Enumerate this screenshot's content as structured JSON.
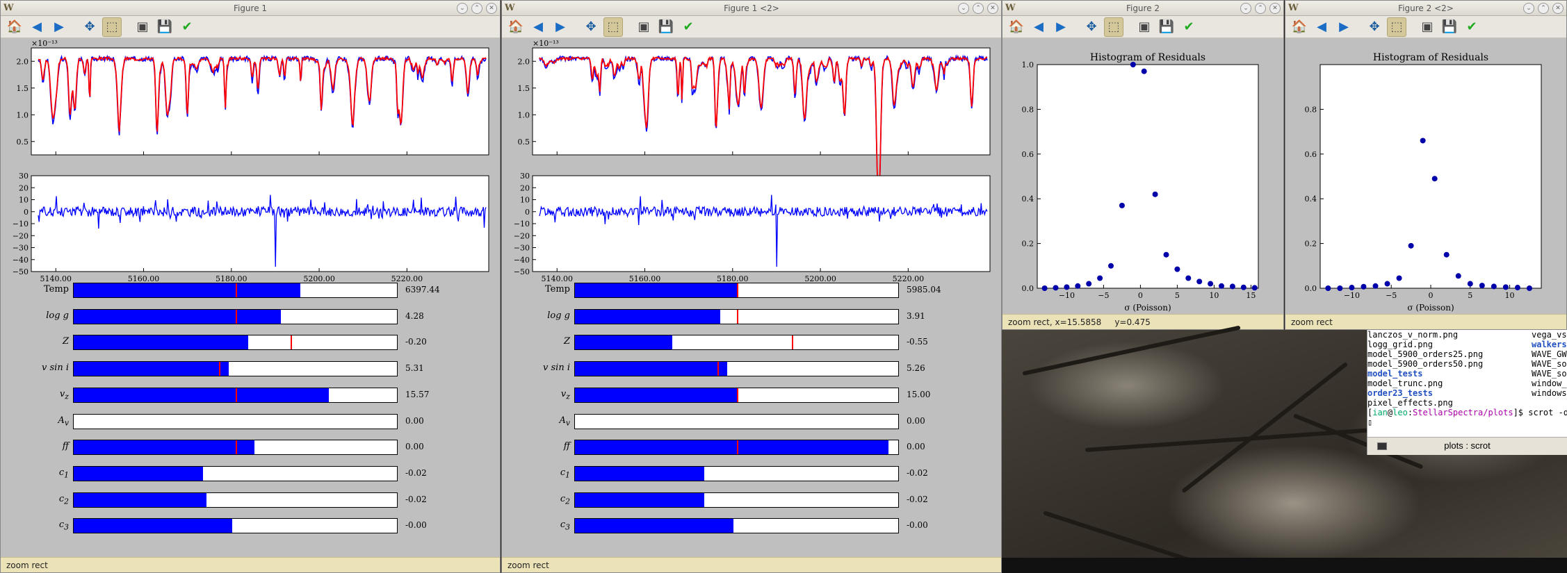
{
  "windows": [
    {
      "title": "Figure 1",
      "status": "zoom rect",
      "top_offset_exponent": "×10⁻¹³",
      "spectrum_yticks": [
        "2.0",
        "1.5",
        "1.0",
        "0.5"
      ],
      "resid_yticks": [
        "30",
        "20",
        "10",
        "0",
        "−10",
        "−20",
        "−30",
        "−40",
        "−50"
      ],
      "xticks": [
        "5140.00",
        "5160.00",
        "5180.00",
        "5200.00",
        "5220.00"
      ],
      "sliders": [
        {
          "label": "Temp",
          "value": "6397.44",
          "fill": 0.7,
          "mark": 0.5
        },
        {
          "label": "log g",
          "value": "4.28",
          "fill": 0.64,
          "mark": 0.5
        },
        {
          "label": "Z",
          "value": "-0.20",
          "fill": 0.54,
          "mark": 0.67
        },
        {
          "label": "v sin i",
          "value": "5.31",
          "fill": 0.48,
          "mark": 0.45
        },
        {
          "label": "v_z",
          "value": "15.57",
          "fill": 0.79,
          "mark": 0.5
        },
        {
          "label": "A_v",
          "value": "0.00",
          "fill": 0.0,
          "mark": null
        },
        {
          "label": "ff",
          "value": "0.00",
          "fill": 0.56,
          "mark": 0.5
        },
        {
          "label": "c_1",
          "value": "-0.02",
          "fill": 0.4,
          "mark": null
        },
        {
          "label": "c_2",
          "value": "-0.02",
          "fill": 0.41,
          "mark": null
        },
        {
          "label": "c_3",
          "value": "-0.00",
          "fill": 0.49,
          "mark": null
        }
      ]
    },
    {
      "title": "Figure 1 <2>",
      "status": "zoom rect",
      "top_offset_exponent": "×10⁻¹³",
      "spectrum_yticks": [
        "2.0",
        "1.5",
        "1.0",
        "0.5"
      ],
      "resid_yticks": [
        "30",
        "20",
        "10",
        "0",
        "−10",
        "−20",
        "−30",
        "−40",
        "−50"
      ],
      "xticks": [
        "5140.00",
        "5160.00",
        "5180.00",
        "5200.00",
        "5220.00"
      ],
      "sliders": [
        {
          "label": "Temp",
          "value": "5985.04",
          "fill": 0.5,
          "mark": 0.5
        },
        {
          "label": "log g",
          "value": "3.91",
          "fill": 0.45,
          "mark": 0.5
        },
        {
          "label": "Z",
          "value": "-0.55",
          "fill": 0.3,
          "mark": 0.67
        },
        {
          "label": "v sin i",
          "value": "5.26",
          "fill": 0.47,
          "mark": 0.44
        },
        {
          "label": "v_z",
          "value": "15.00",
          "fill": 0.5,
          "mark": 0.5
        },
        {
          "label": "A_v",
          "value": "0.00",
          "fill": 0.0,
          "mark": null
        },
        {
          "label": "ff",
          "value": "0.00",
          "fill": 0.97,
          "mark": 0.5
        },
        {
          "label": "c_1",
          "value": "-0.02",
          "fill": 0.4,
          "mark": null
        },
        {
          "label": "c_2",
          "value": "-0.02",
          "fill": 0.4,
          "mark": null
        },
        {
          "label": "c_3",
          "value": "-0.00",
          "fill": 0.49,
          "mark": null
        }
      ]
    }
  ],
  "histograms": [
    {
      "title": "Figure 2",
      "status": "zoom rect, x=15.5858     y=0.475",
      "chart_data": {
        "type": "scatter",
        "title": "Histogram of Residuals",
        "xlabel": "σ (Poisson)",
        "xlim": [
          -14,
          16
        ],
        "ylim": [
          0,
          1.0
        ],
        "xticks": [
          "−10",
          "−5",
          "0",
          "5",
          "10",
          "15"
        ],
        "yticks": [
          "0.0",
          "0.2",
          "0.4",
          "0.6",
          "0.8",
          "1.0"
        ],
        "x": [
          -13,
          -11.5,
          -10,
          -8.5,
          -7,
          -5.5,
          -4,
          -2.5,
          -1,
          0.5,
          2,
          3.5,
          5,
          6.5,
          8,
          9.5,
          11,
          12.5,
          14,
          15.5
        ],
        "y": [
          0.0,
          0.002,
          0.005,
          0.01,
          0.02,
          0.045,
          0.1,
          0.37,
          1.0,
          0.97,
          0.42,
          0.15,
          0.085,
          0.045,
          0.03,
          0.02,
          0.01,
          0.008,
          0.004,
          0.002
        ]
      }
    },
    {
      "title": "Figure 2 <2>",
      "status": "zoom rect",
      "chart_data": {
        "type": "scatter",
        "title": "Histogram of Residuals",
        "xlabel": "σ (Poisson)",
        "xlim": [
          -14,
          14
        ],
        "ylim": [
          0,
          1.0
        ],
        "xticks": [
          "−10",
          "−5",
          "0",
          "5",
          "10"
        ],
        "yticks": [
          "0.0",
          "0.2",
          "0.4",
          "0.6",
          "0.8"
        ],
        "x": [
          -13,
          -11.5,
          -10,
          -8.5,
          -7,
          -5.5,
          -4,
          -2.5,
          -1,
          0.5,
          2,
          3.5,
          5,
          6.5,
          8,
          9.5,
          11,
          12.5
        ],
        "y": [
          0.0,
          0.0,
          0.003,
          0.007,
          0.01,
          0.02,
          0.045,
          0.19,
          0.66,
          0.49,
          0.15,
          0.055,
          0.02,
          0.012,
          0.008,
          0.005,
          0.003,
          0.0
        ]
      }
    }
  ],
  "terminal": {
    "lines": [
      {
        "c1": "lanczos_v_norm.png",
        "c2": "vega_vs",
        "c1blue": false,
        "c2blue": false
      },
      {
        "c1": "logg_grid.png",
        "c2": "walkers",
        "c1blue": false,
        "c2blue": true
      },
      {
        "c1": "model_5900_orders25.png",
        "c2": "WAVE_GWO",
        "c1blue": false,
        "c2blue": false
      },
      {
        "c1": "model_5900_orders50.png",
        "c2": "WAVE_sol",
        "c1blue": false,
        "c2blue": false
      },
      {
        "c1": "model_tests",
        "c2": "WAVE_sol",
        "c1blue": true,
        "c2blue": false
      },
      {
        "c1": "model_trunc.png",
        "c2": "window_m",
        "c1blue": false,
        "c2blue": false
      },
      {
        "c1": "order23_tests",
        "c2": "windows.",
        "c1blue": true,
        "c2blue": false
      },
      {
        "c1": "pixel_effects.png",
        "c2": "",
        "c1blue": false,
        "c2blue": false
      }
    ],
    "prompt_user": "ian",
    "prompt_host": "leo",
    "prompt_path": "StellarSpectra/plots",
    "prompt_cmd": "]$ scrot -d",
    "status": "plots : scrot"
  },
  "colors": {
    "model": "#ff0000",
    "data": "#0000ff",
    "fill": "#0000ff",
    "mark": "#ff0000"
  }
}
